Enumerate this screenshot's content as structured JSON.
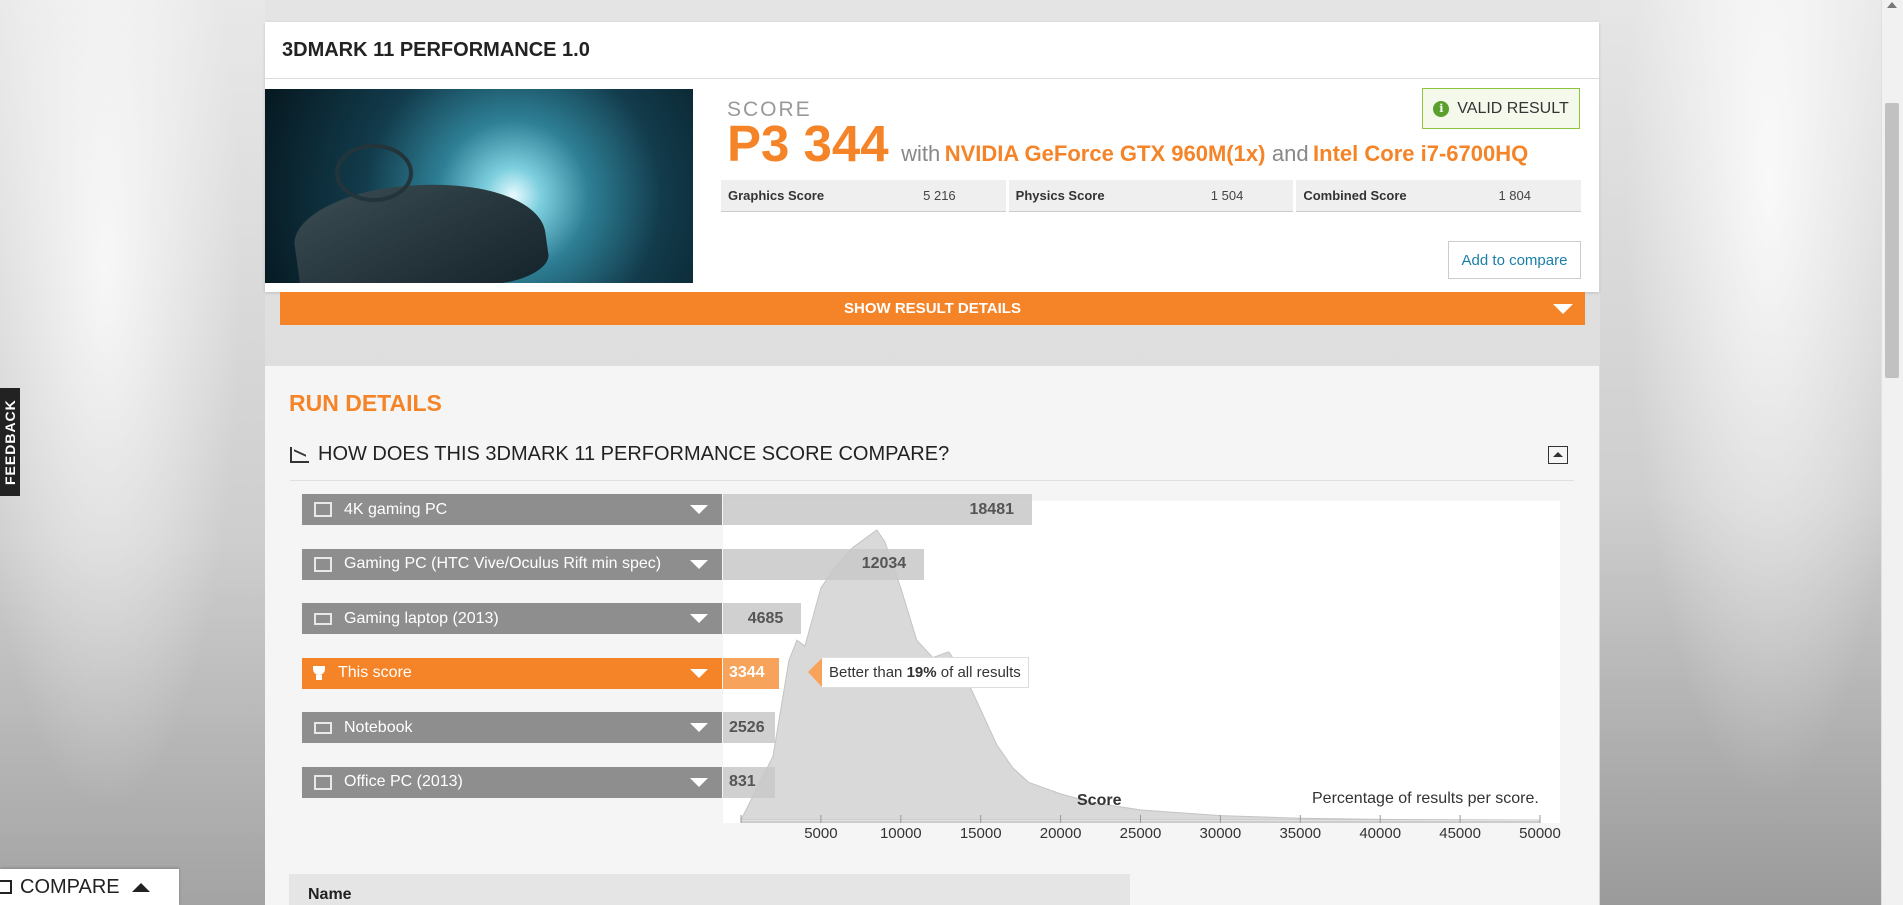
{
  "result": {
    "title": "3DMARK 11 PERFORMANCE 1.0",
    "score_label": "SCORE",
    "score_value": "P3 344",
    "with_text": "with",
    "gpu": "NVIDIA GeForce GTX 960M(1x)",
    "and_text": "and",
    "cpu": "Intel Core i7-6700HQ",
    "valid_label": "VALID RESULT",
    "subscores": [
      {
        "label": "Graphics Score",
        "value": "5 216"
      },
      {
        "label": "Physics Score",
        "value": "1 504"
      },
      {
        "label": "Combined Score",
        "value": "1 804"
      }
    ],
    "compare_label": "Add to compare",
    "show_details_label": "SHOW RESULT DETAILS"
  },
  "run_details": {
    "title": "RUN DETAILS",
    "compare_heading": "HOW DOES THIS 3DMARK 11 PERFORMANCE SCORE COMPARE?"
  },
  "chart_data": {
    "type": "area",
    "title": "",
    "xlabel": "Score",
    "note": "Percentage of results per score.",
    "xlim": [
      0,
      50000
    ],
    "x_ticks": [
      5000,
      10000,
      15000,
      20000,
      25000,
      30000,
      35000,
      40000,
      45000,
      50000
    ],
    "distribution": {
      "x": [
        0,
        2000,
        3000,
        3500,
        4000,
        5000,
        6000,
        7000,
        8000,
        8500,
        9000,
        10000,
        11000,
        12000,
        13000,
        14000,
        15000,
        16000,
        17000,
        18000,
        20000,
        22000,
        25000,
        30000,
        35000,
        40000,
        50000
      ],
      "y": [
        0,
        0.22,
        0.55,
        0.62,
        0.6,
        0.8,
        0.88,
        0.94,
        0.98,
        1.0,
        0.96,
        0.8,
        0.62,
        0.56,
        0.58,
        0.5,
        0.38,
        0.26,
        0.18,
        0.13,
        0.09,
        0.06,
        0.035,
        0.015,
        0.006,
        0.002,
        0
      ]
    },
    "comparisons": [
      {
        "label": "4K gaming PC",
        "value": 18481,
        "icon": "desktop-icon",
        "highlight": false
      },
      {
        "label": "Gaming PC (HTC Vive/Oculus Rift min spec)",
        "value": 12034,
        "icon": "desktop-icon",
        "highlight": false
      },
      {
        "label": "Gaming laptop (2013)",
        "value": 4685,
        "icon": "laptop-icon",
        "highlight": false
      },
      {
        "label": "This score",
        "value": 3344,
        "icon": "trophy-icon",
        "highlight": true
      },
      {
        "label": "Notebook",
        "value": 2526,
        "icon": "laptop-icon",
        "highlight": false
      },
      {
        "label": "Office PC (2013)",
        "value": 831,
        "icon": "desktop-icon",
        "highlight": false
      }
    ],
    "better_than": {
      "prefix": "Better than",
      "percent": "19%",
      "suffix": "of all results"
    }
  },
  "table": {
    "name_header": "Name"
  },
  "side": {
    "feedback_label": "FEEDBACK",
    "compare_label": "COMPARE"
  },
  "colors": {
    "accent": "#f58428",
    "valid": "#5aa02c",
    "link": "#1a7fa8"
  }
}
